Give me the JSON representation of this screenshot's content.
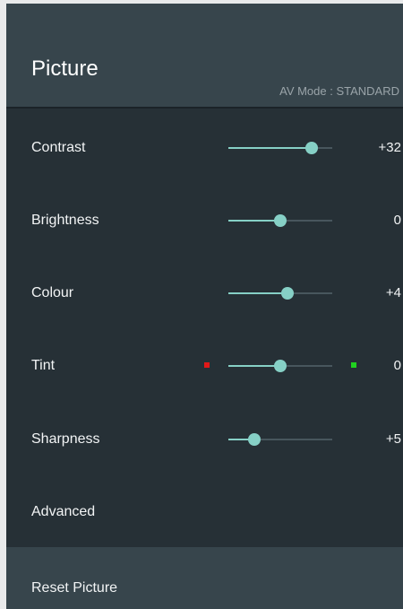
{
  "header": {
    "title": "Picture",
    "av_mode": "AV Mode : STANDARD"
  },
  "colors": {
    "accent": "#86d0c6",
    "panel_bg": "#263036",
    "header_bg": "#37454c",
    "tint_red": "#e11818",
    "tint_green": "#20d220"
  },
  "settings": [
    {
      "label": "Contrast",
      "value": "+32",
      "level": 0.8
    },
    {
      "label": "Brightness",
      "value": "0",
      "level": 0.5
    },
    {
      "label": "Colour",
      "value": "+4",
      "level": 0.57
    },
    {
      "label": "Tint",
      "value": "0",
      "level": 0.5
    },
    {
      "label": "Sharpness",
      "value": "+5",
      "level": 0.25
    }
  ],
  "advanced": {
    "label": "Advanced"
  },
  "reset": {
    "label": "Reset Picture"
  }
}
